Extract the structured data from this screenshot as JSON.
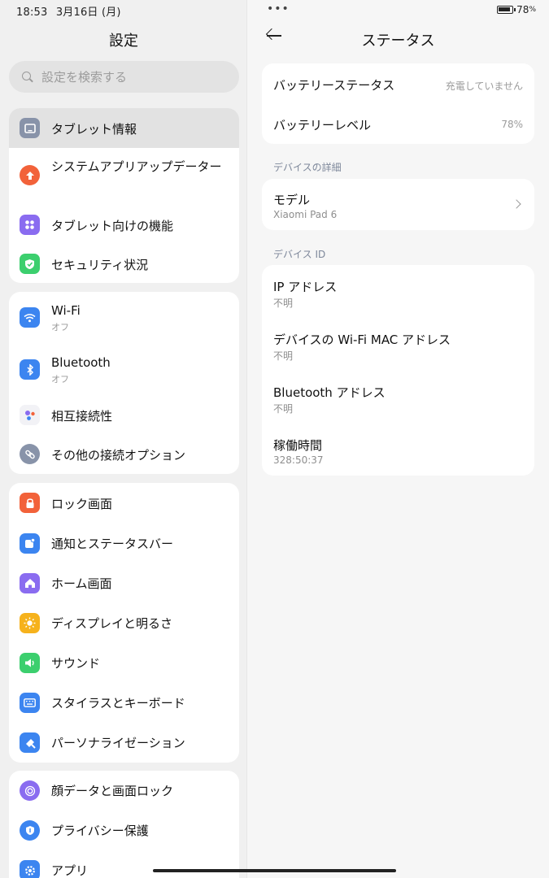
{
  "status": {
    "time": "18:53",
    "date": "3月16日 (月)",
    "battery_pct": "78",
    "battery_pct_symbol": "%"
  },
  "settings": {
    "title": "設定",
    "search_placeholder": "設定を検索する",
    "groups": [
      {
        "items": [
          {
            "label": "タブレット情報",
            "icon": "tablet-icon",
            "color": "#8893a9",
            "selected": true
          },
          {
            "label": "システムアプリアップデーター",
            "icon": "arrow-up-icon",
            "color": "#f2623a"
          },
          {
            "label": "タブレット向けの機能",
            "icon": "grid-icon",
            "color": "#8a6cf0"
          },
          {
            "label": "セキュリティ状況",
            "icon": "shield-icon",
            "color": "#3ccf6e"
          }
        ]
      },
      {
        "items": [
          {
            "label": "Wi-Fi",
            "sub": "オフ",
            "icon": "wifi-icon",
            "color": "#3c85f0"
          },
          {
            "label": "Bluetooth",
            "sub": "オフ",
            "icon": "bluetooth-icon",
            "color": "#3c85f0"
          },
          {
            "label": "相互接続性",
            "icon": "interconnect-icon",
            "color": "#ffffff"
          },
          {
            "label": "その他の接続オプション",
            "icon": "link-icon",
            "color": "#8893a9"
          }
        ]
      },
      {
        "items": [
          {
            "label": "ロック画面",
            "icon": "lock-icon",
            "color": "#f2623a"
          },
          {
            "label": "通知とステータスバー",
            "icon": "notification-icon",
            "color": "#3c85f0"
          },
          {
            "label": "ホーム画面",
            "icon": "home-icon",
            "color": "#8a6cf0"
          },
          {
            "label": "ディスプレイと明るさ",
            "icon": "sun-icon",
            "color": "#f6b21c"
          },
          {
            "label": "サウンド",
            "icon": "speaker-icon",
            "color": "#3ccf6e"
          },
          {
            "label": "スタイラスとキーボード",
            "icon": "keyboard-icon",
            "color": "#3c85f0"
          },
          {
            "label": "パーソナライゼーション",
            "icon": "brush-icon",
            "color": "#3c85f0"
          }
        ]
      },
      {
        "items": [
          {
            "label": "顔データと画面ロック",
            "icon": "face-icon",
            "color": "#8a6cf0"
          },
          {
            "label": "プライバシー保護",
            "icon": "privacy-icon",
            "color": "#3c85f0"
          },
          {
            "label": "アプリ",
            "icon": "gear-icon",
            "color": "#3c85f0"
          }
        ]
      }
    ]
  },
  "detail": {
    "title": "ステータス",
    "battery": {
      "status_label": "バッテリーステータス",
      "status_value": "充電していません",
      "level_label": "バッテリーレベル",
      "level_value": "78%"
    },
    "device_section": "デバイスの詳細",
    "model_label": "モデル",
    "model_value": "Xiaomi Pad 6",
    "id_section": "デバイス ID",
    "ids": [
      {
        "label": "IP アドレス",
        "value": "不明"
      },
      {
        "label": "デバイスの Wi-Fi MAC アドレス",
        "value": "不明"
      },
      {
        "label": "Bluetooth アドレス",
        "value": "不明"
      },
      {
        "label": "稼働時間",
        "value": "328:50:37"
      }
    ]
  }
}
